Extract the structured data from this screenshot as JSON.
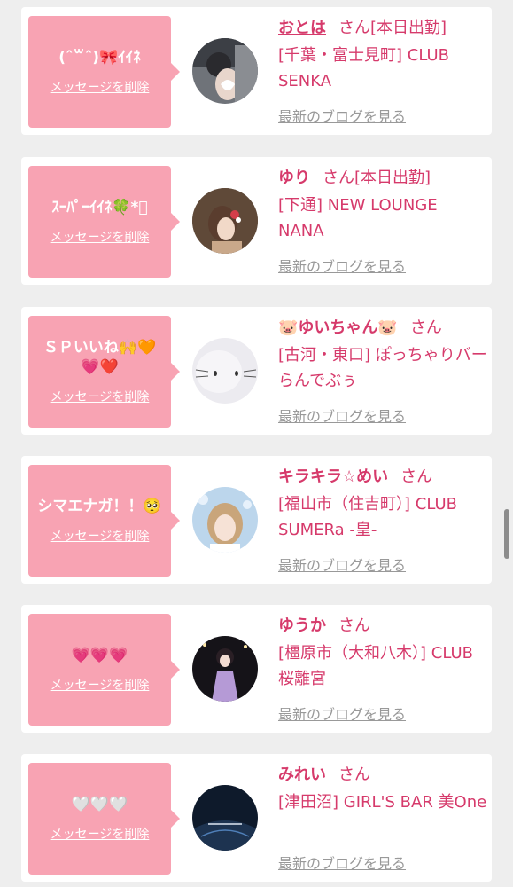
{
  "common": {
    "delete_label": "メッセージを削除",
    "blog_label": "最新のブログを見る",
    "san": "さん"
  },
  "colors": {
    "background": "#eeeeee",
    "bubble": "#f8a3b3",
    "name": "#d63a6b",
    "link_gray": "#999999"
  },
  "items": [
    {
      "message": "(ˆ꒳ˆ)🎀ｲｲﾈ",
      "name": "おとは",
      "status": "[本日出勤]",
      "shop": "[千葉・富士見町] CLUB SENKA"
    },
    {
      "message": "ｽｰﾊﾟｰｲｲﾈ🍀*ﾟ",
      "name": "ゆり",
      "status": "[本日出勤]",
      "shop": "[下通] NEW LOUNGE NANA"
    },
    {
      "message": "ＳＰいいね🙌🧡💗❤️",
      "name": "🐷ゆいちゃん🐷",
      "status": "",
      "shop": "[古河・東口] ぽっちゃりバー らんでぶぅ"
    },
    {
      "message": "シマエナガ！！🥺",
      "name": "キラキラ☆めい",
      "status": "",
      "shop": "[福山市（住吉町）] CLUB SUMERa -皇-"
    },
    {
      "message": "💗💗💗",
      "name": "ゆうか",
      "status": "",
      "shop": "[橿原市（大和八木）] CLUB 桜離宮"
    },
    {
      "message": "🤍🤍🤍",
      "name": "みれい",
      "status": "",
      "shop": "[津田沼] GIRL'S BAR 美One"
    }
  ]
}
